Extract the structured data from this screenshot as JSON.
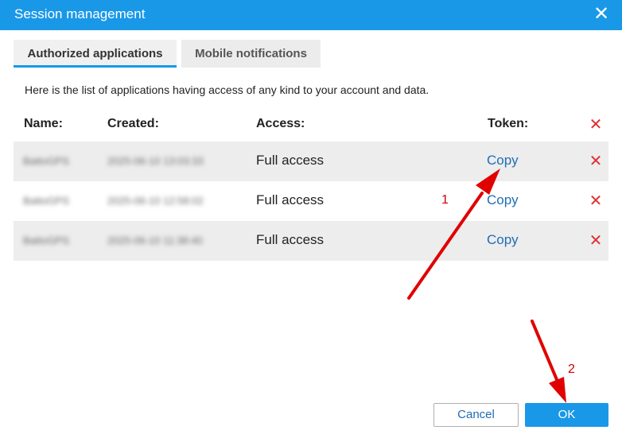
{
  "dialog": {
    "title": "Session management",
    "close_glyph": "✕"
  },
  "tabs": [
    {
      "label": "Authorized applications",
      "active": true
    },
    {
      "label": "Mobile notifications",
      "active": false
    }
  ],
  "intro_text": "Here is the list of applications having access of any kind to your account and data.",
  "table": {
    "headers": {
      "name": "Name:",
      "created": "Created:",
      "access": "Access:",
      "token": "Token:"
    },
    "delete_glyph": "✕",
    "rows": [
      {
        "name": "BattoGPS",
        "created": "2025-06-10 13:03:33",
        "access": "Full access",
        "token_action": "Copy"
      },
      {
        "name": "BattoGPS",
        "created": "2025-06-10 12:58:02",
        "access": "Full access",
        "token_action": "Copy"
      },
      {
        "name": "BattoGPS",
        "created": "2025-06-10 11:38:40",
        "access": "Full access",
        "token_action": "Copy"
      }
    ]
  },
  "annotations": {
    "step1": "1",
    "step2": "2"
  },
  "footer": {
    "cancel_label": "Cancel",
    "ok_label": "OK"
  },
  "colors": {
    "accent": "#1a98e8",
    "link": "#1f6db4",
    "delete": "#e03030",
    "annotation": "#e00000"
  }
}
